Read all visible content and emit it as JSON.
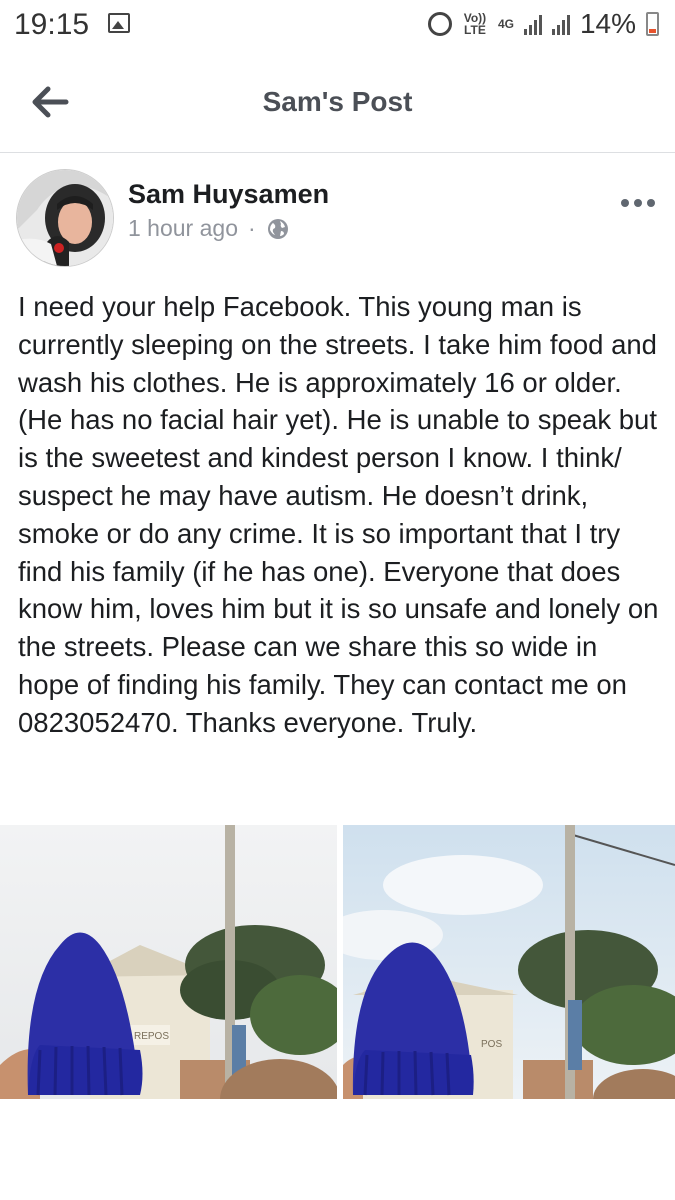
{
  "status_bar": {
    "time": "19:15",
    "volte_label": "Vo)) LTE",
    "network_label": "4G",
    "battery": "14%",
    "icons": [
      "gallery-icon",
      "alarm-icon",
      "signal-icon",
      "signal-icon",
      "battery-icon"
    ]
  },
  "header": {
    "title": "Sam's Post",
    "back_icon": "arrow-left-icon"
  },
  "post": {
    "author": "Sam Huysamen",
    "timestamp": "1 hour ago",
    "separator": "·",
    "privacy_icon": "globe-icon",
    "more_icon": "more-options-icon",
    "text": "I need your help Facebook. This young man is currently sleeping on the streets. I take him food and wash his clothes. He is approximately 16 or older. (He has no facial hair yet). He is unable to speak but is the sweetest and kindest person I know. I think/ suspect he may have autism. He doesn’t drink, smoke or do any crime. It is so important that I try find his family (if he has one). Everyone that does know him, loves him but it is so unsafe and lonely on the streets. Please can we share this so wide in hope of finding his family. They can contact me on 0823052470. Thanks everyone. Truly.",
    "photos": [
      {
        "sign_text": "REPOS",
        "hat_color": "#2c2fa6"
      },
      {
        "sign_text": "POS",
        "hat_color": "#2c2fa6"
      }
    ]
  },
  "colors": {
    "text": "#1c1e21",
    "secondary_text": "#90949c",
    "header_text": "#4b4f56",
    "divider": "#dddfe2"
  }
}
